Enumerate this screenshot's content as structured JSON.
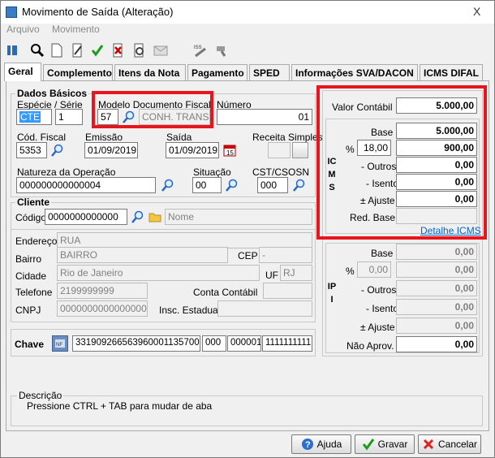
{
  "window": {
    "title": "Movimento de Saída (Alteração)",
    "close": "X"
  },
  "menu": [
    "Arquivo",
    "Movimento"
  ],
  "tabs": [
    "Geral",
    "Complemento",
    "Itens da Nota",
    "Pagamento",
    "SPED",
    "Informações SVA/DACON",
    "ICMS DIFAL"
  ],
  "dados_basicos": {
    "title": "Dados Básicos",
    "especie_serie_label": "Espécie  /  Série",
    "especie": "CTE",
    "serie": "1",
    "modelo_label": "Modelo Documento Fiscal",
    "modelo_code": "57",
    "modelo_desc": "CONH. TRANSPO",
    "numero_label": "Número",
    "numero": "01",
    "cod_fiscal_label": "Cód. Fiscal",
    "cod_fiscal": "5353",
    "emissao_label": "Emissão",
    "emissao": "01/09/2019",
    "saida_label": "Saída",
    "saida": "01/09/2019",
    "receita_label": "Receita Simples",
    "natureza_label": "Natureza da Operação",
    "natureza": "000000000000004",
    "situacao_label": "Situação",
    "situacao": "00",
    "cst_label": "CST/CSOSN",
    "cst": "000"
  },
  "cliente": {
    "title": "Cliente",
    "codigo_label": "Código",
    "codigo": "0000000000000",
    "nome_placeholder": "Nome",
    "endereco_label": "Endereço",
    "endereco": "RUA",
    "bairro_label": "Bairro",
    "bairro": "BAIRRO",
    "cep_label": "CEP",
    "cep": "-",
    "cidade_label": "Cidade",
    "cidade": "Rio de Janeiro",
    "uf_label": "UF",
    "uf": "RJ",
    "telefone_label": "Telefone",
    "telefone": "2199999999",
    "conta_label": "Conta Contábil",
    "cnpj_label": "CNPJ",
    "cnpj": "0000000000000000",
    "insc_label": "Insc. Estadual"
  },
  "chave": {
    "label": "Chave",
    "p1": "33190926656396000113570010",
    "p2": "000",
    "p3": "000001",
    "p4": "1111111111"
  },
  "icms": {
    "valor_contabil_label": "Valor Contábil",
    "valor_contabil": "5.000,00",
    "vertical": "ICMS",
    "base_label": "Base",
    "base": "5.000,00",
    "pct_label": "%",
    "pct": "18,00",
    "pct_value": "900,00",
    "outros_label": "- Outros",
    "outros": "0,00",
    "isento_label": "- Isento",
    "isento": "0,00",
    "ajuste_label": "± Ajuste",
    "ajuste": "0,00",
    "red_base_label": "Red. Base",
    "detalhe_link": "Detalhe ICMS"
  },
  "ipi": {
    "vertical": "IPI",
    "base_label": "Base",
    "base": "0,00",
    "pct_label": "%",
    "pct": "0,00",
    "pct_value": "0,00",
    "outros_label": "- Outros",
    "outros": "0,00",
    "isento_label": "- Isento",
    "isento": "0,00",
    "ajuste_label": "± Ajuste",
    "ajuste": "0,00",
    "nao_aprov_label": "Não Aprov.",
    "nao_aprov": "0,00"
  },
  "descricao": {
    "title": "Descrição",
    "text": "Pressione CTRL + TAB para  mudar de aba"
  },
  "buttons": {
    "ajuda": "Ajuda",
    "gravar": "Gravar",
    "cancelar": "Cancelar"
  },
  "colors": {
    "highlight": "#e8151c",
    "link": "#0066cc",
    "selection": "#3399ff"
  }
}
